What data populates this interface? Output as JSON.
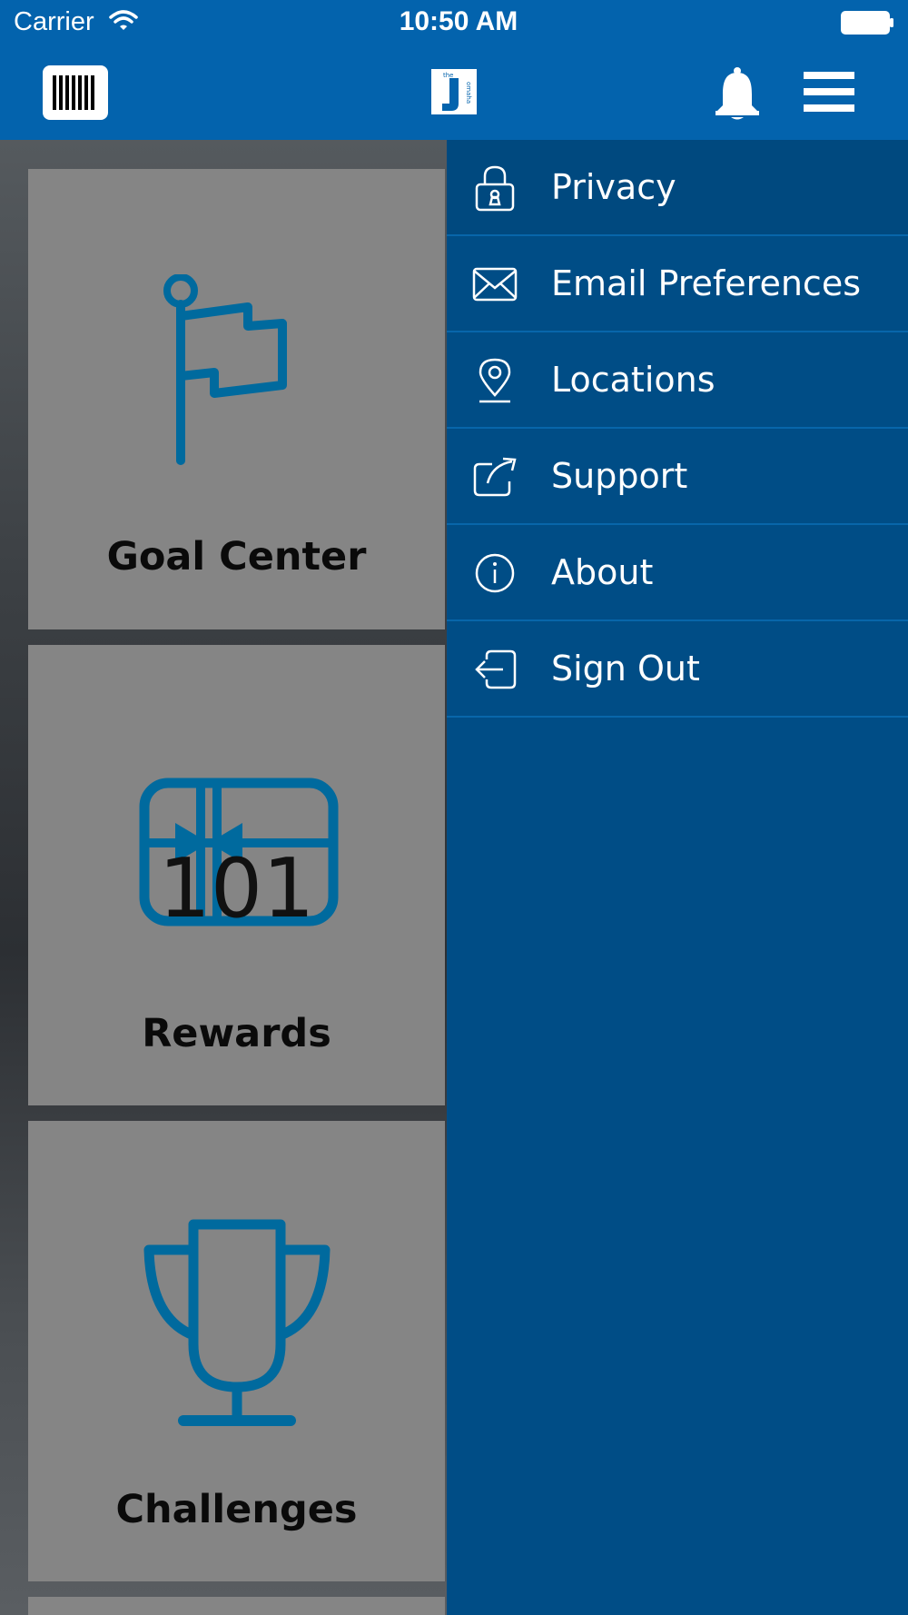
{
  "status_bar": {
    "carrier": "Carrier",
    "time": "10:50 AM"
  },
  "nav_bar": {
    "background": "#0363ad",
    "icons": [
      "barcode-icon",
      "the-j-omaha-logo",
      "bell-icon",
      "hamburger-menu-icon"
    ]
  },
  "logo": {
    "small_text": "the",
    "letter": "J",
    "side_text": "omaha"
  },
  "tiles": {
    "goal_center": {
      "label": "Goal Center",
      "icon": "flag-icon"
    },
    "rewards": {
      "label": "Rewards",
      "icon": "gift-card-icon",
      "count": "101"
    },
    "challenges": {
      "label": "Challenges",
      "icon": "trophy-icon"
    },
    "icon_color": "#006a9e"
  },
  "side_menu": {
    "background": "#004d86",
    "items": [
      {
        "label": "Privacy",
        "icon": "lock-icon"
      },
      {
        "label": "Email Preferences",
        "icon": "envelope-icon"
      },
      {
        "label": "Locations",
        "icon": "map-pin-icon"
      },
      {
        "label": "Support",
        "icon": "external-link-icon"
      },
      {
        "label": "About",
        "icon": "info-icon"
      },
      {
        "label": "Sign Out",
        "icon": "sign-out-icon"
      }
    ]
  }
}
